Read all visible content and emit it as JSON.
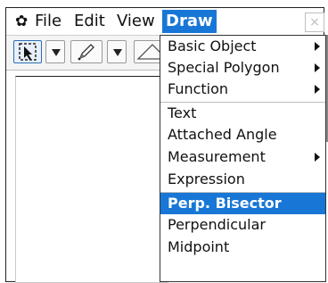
{
  "menubar": {
    "settings_icon": "gear-icon",
    "items": [
      "File",
      "Edit",
      "View",
      "Draw"
    ],
    "close_glyph": "×"
  },
  "toolbar": {
    "icons": [
      "select-arrow-icon",
      "dropdown-triangle-icon",
      "pencil-icon",
      "dropdown-triangle-icon",
      "triangle-tool-icon"
    ]
  },
  "draw_menu": {
    "items": [
      {
        "label": "Basic Object",
        "submenu": true
      },
      {
        "label": "Special Polygon",
        "submenu": true
      },
      {
        "label": "Function",
        "submenu": true
      },
      {
        "label": "Text",
        "submenu": false
      },
      {
        "label": "Attached Angle",
        "submenu": false
      },
      {
        "label": "Measurement",
        "submenu": true
      },
      {
        "label": "Expression",
        "submenu": false
      },
      {
        "label": "Perp. Bisector",
        "submenu": false,
        "selected": true
      },
      {
        "label": "Perpendicular",
        "submenu": false
      },
      {
        "label": "Midpoint",
        "submenu": false
      }
    ]
  },
  "colors": {
    "accent": "#1877d6"
  }
}
